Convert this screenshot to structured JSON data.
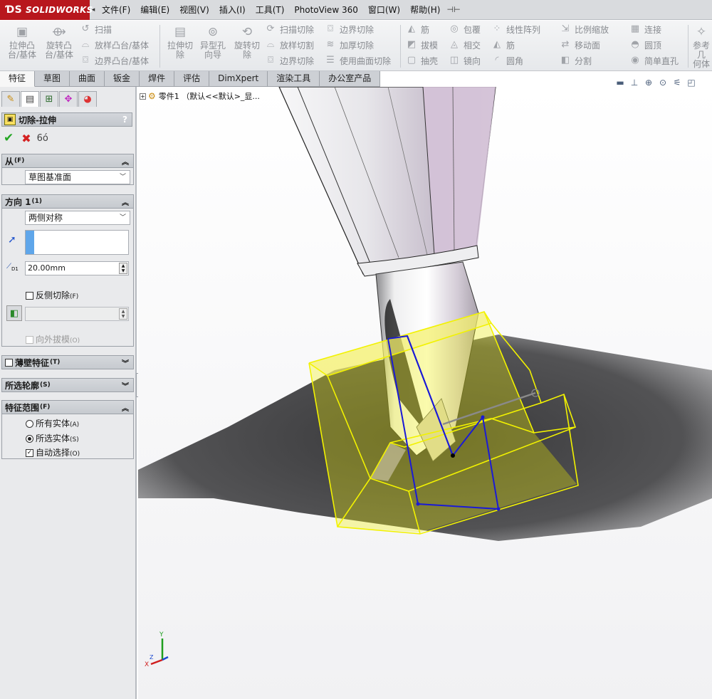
{
  "app": {
    "logo": "SOLIDWORKS"
  },
  "menu": [
    "文件(F)",
    "编辑(E)",
    "视图(V)",
    "插入(I)",
    "工具(T)",
    "PhotoView 360",
    "窗口(W)",
    "帮助(H)"
  ],
  "commands": {
    "extrude_boss": "拉伸凸\n台/基体",
    "revolve_boss": "旋转凸\n台/基体",
    "sweep": "扫描",
    "loft_boss": "放样凸台/基体",
    "boundary_boss": "边界凸台/基体",
    "extrude_cut": "拉伸切\n除",
    "hole_wizard": "异型孔\n向导",
    "revolve_cut": "旋转切\n除",
    "swept_cut": "扫描切除",
    "lofted_cut": "放样切割",
    "boundary_cut": "边界切除",
    "boundary_cut2": "边界切除",
    "thicken_cut": "加厚切除",
    "surface_cut": "使用曲面切除",
    "rib": "筋",
    "draft": "拔模",
    "shell": "抽壳",
    "wrap": "包覆",
    "intersect": "相交",
    "mirror": "镜向",
    "linear_pattern": "线性阵列",
    "rib2": "筋",
    "fillet": "圆角",
    "scale": "比例缩放",
    "move_face": "移动面",
    "split": "分割",
    "connect": "连接",
    "dome": "圆顶",
    "simple_hole": "简单直孔",
    "ref_geometry": "参考几\n何体"
  },
  "tabs": [
    "特征",
    "草图",
    "曲面",
    "钣金",
    "焊件",
    "评估",
    "DimXpert",
    "渲染工具",
    "办公室产品"
  ],
  "tree": {
    "part_label": "零件1 （默认<<默认>_显..."
  },
  "property_manager": {
    "title": "切除-拉伸",
    "help": "?",
    "from_group": {
      "label": "从",
      "key": "(F)",
      "value": "草图基准面"
    },
    "direction_group": {
      "label": "方向 1",
      "key": "(1)",
      "end_condition": "两侧对称",
      "depth": "20.00mm",
      "flip_side_label": "反侧切除",
      "flip_side_key": "(F)",
      "draft_outward_label": "向外拔模",
      "draft_outward_key": "(O)"
    },
    "thin_group": {
      "label": "薄壁特征",
      "key": "(T)"
    },
    "contours_group": {
      "label": "所选轮廓",
      "key": "(S)"
    },
    "scope_group": {
      "label": "特征范围",
      "key": "(F)",
      "all_bodies": "所有实体",
      "all_bodies_key": "(A)",
      "selected_bodies": "所选实体",
      "selected_bodies_key": "(S)",
      "auto_select": "自动选择",
      "auto_select_key": "(O)"
    }
  },
  "triad": {
    "x": "X",
    "y": "Y",
    "z": "Z"
  },
  "colors": {
    "brand": "#b8171d",
    "highlight": "#f2f200",
    "sketch": "#1a1ad6"
  }
}
